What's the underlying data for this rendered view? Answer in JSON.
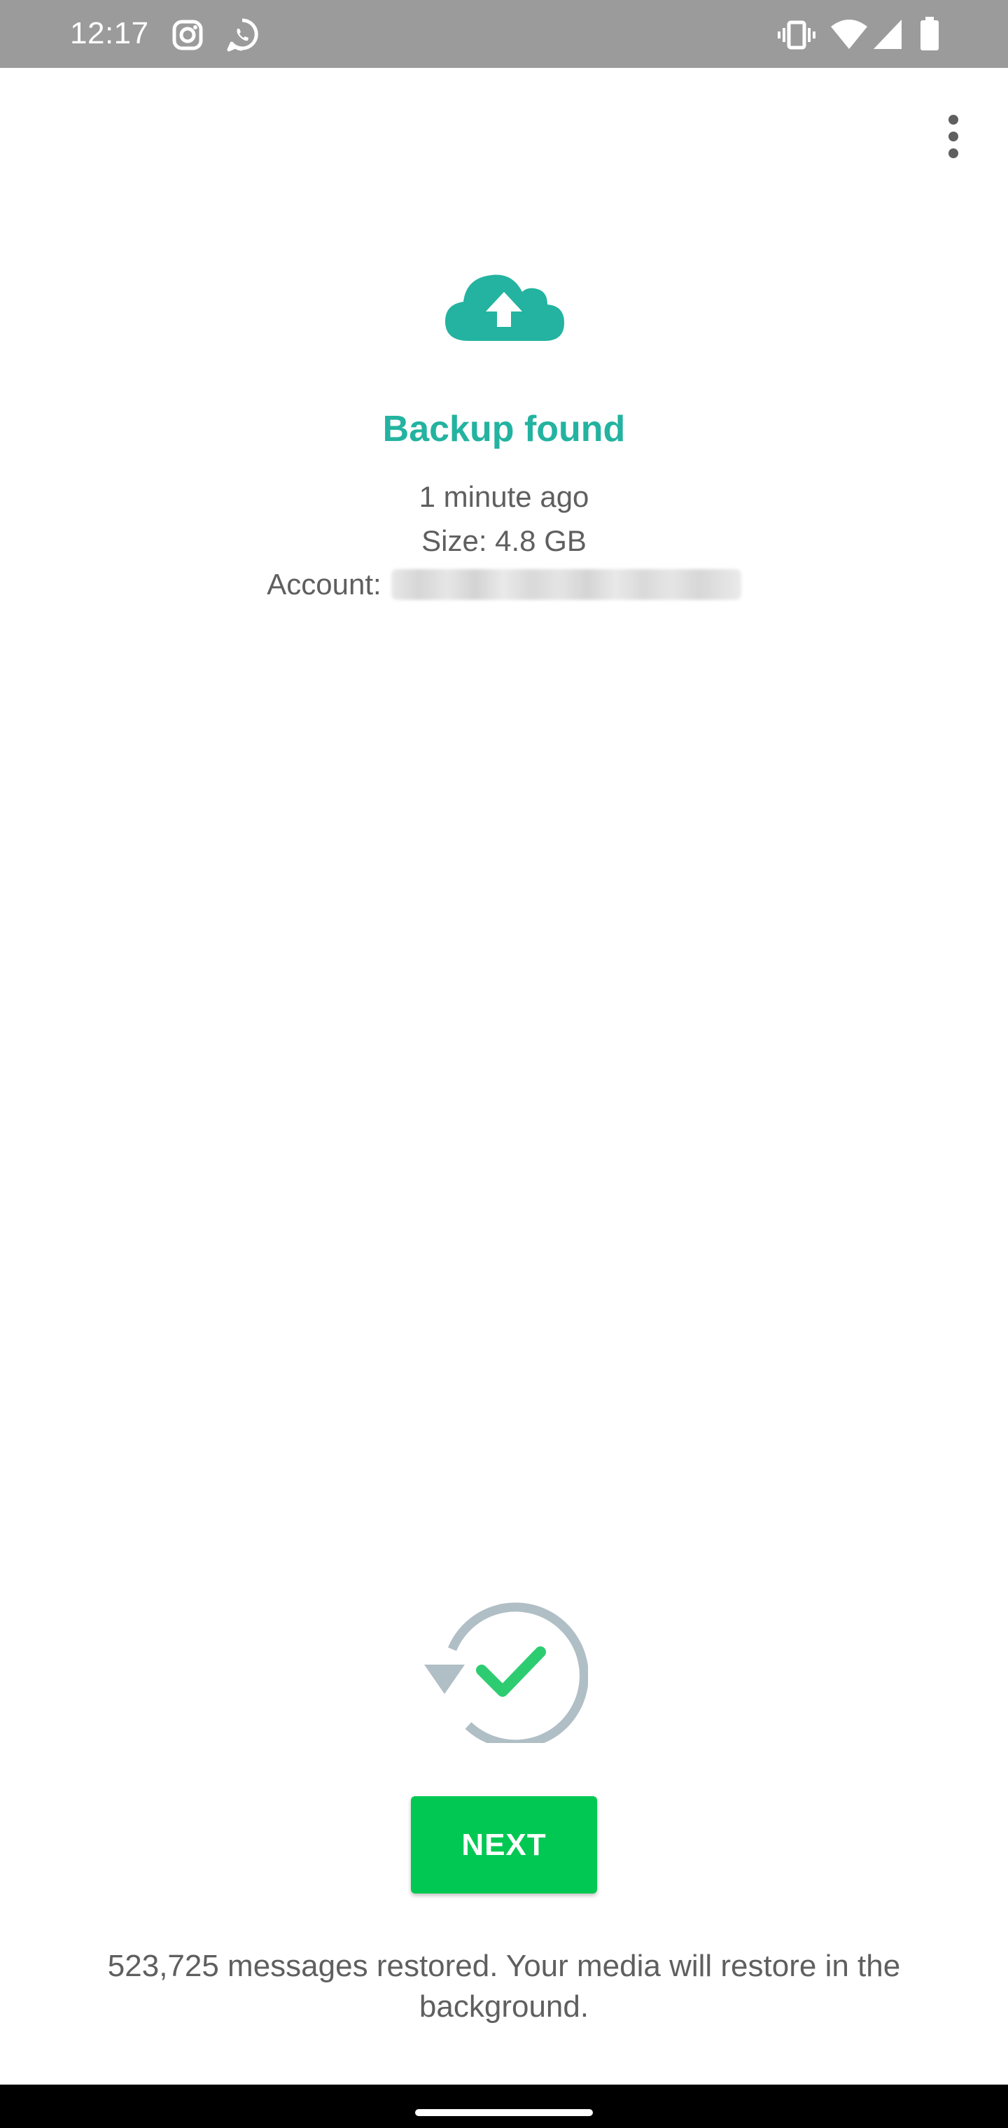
{
  "status_bar": {
    "time": "12:17",
    "left_icons": [
      "instagram-icon",
      "whatsapp-icon"
    ],
    "right_icons": [
      "vibrate-icon",
      "wifi-icon",
      "signal-icon",
      "battery-icon"
    ]
  },
  "toolbar": {
    "overflow_icon": "more-vert-icon"
  },
  "backup": {
    "icon": "cloud-upload-icon",
    "title": "Backup found",
    "time_ago": "1 minute ago",
    "size": "Size: 4.8 GB",
    "account_label": "Account:"
  },
  "restore": {
    "icon": "restore-complete-icon",
    "next_label": "NEXT",
    "message": "523,725 messages restored. Your media will restore in the background."
  },
  "colors": {
    "accent": "#23b3a0",
    "button": "#00c853",
    "check": "#2ecc71",
    "ring": "#b0bec5",
    "status_bar": "#9b9b9b",
    "text": "#5f5f5f"
  }
}
